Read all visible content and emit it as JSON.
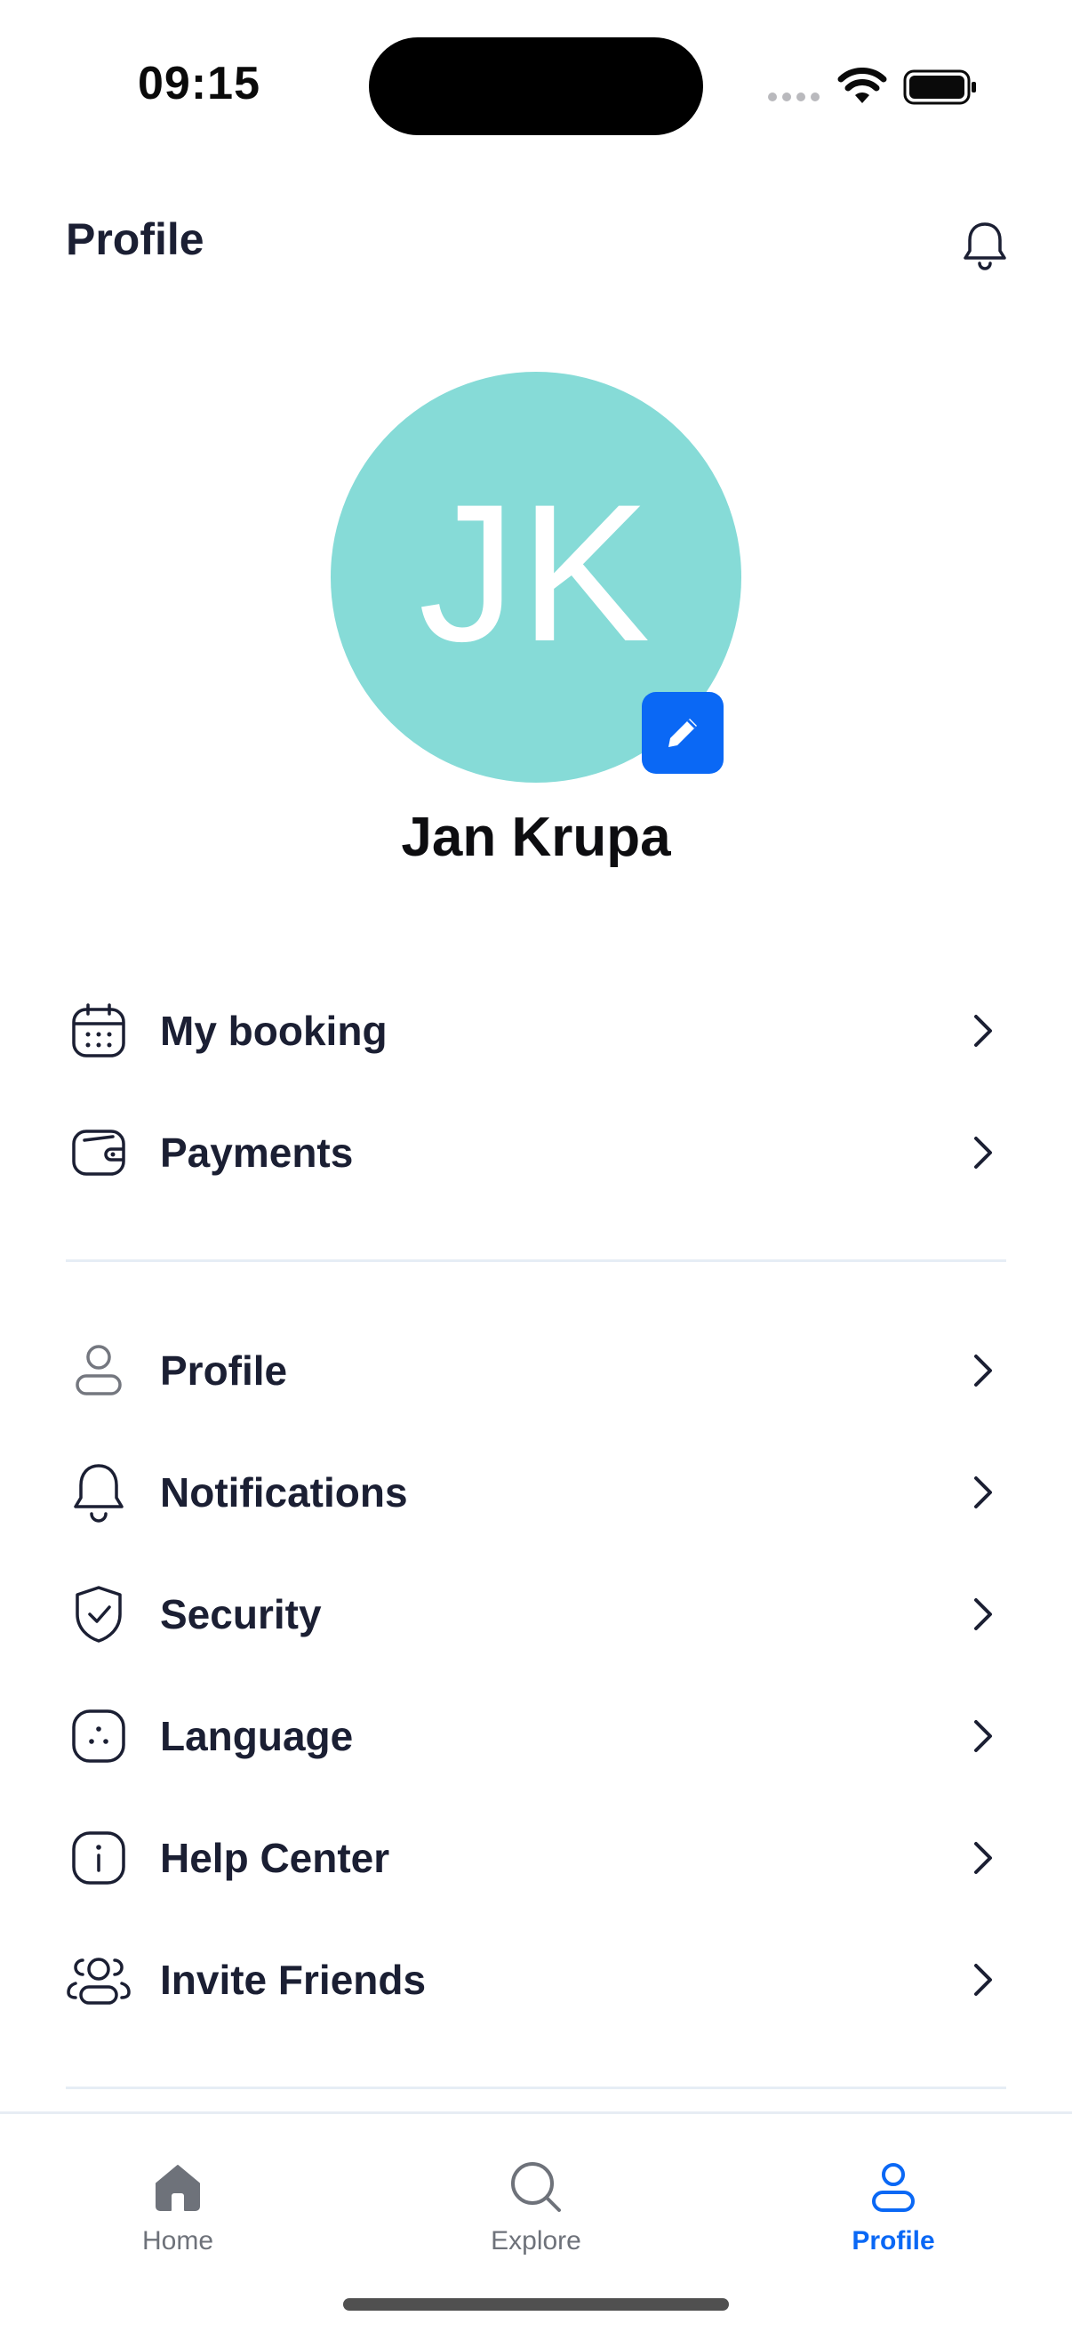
{
  "status_bar": {
    "time": "09:15"
  },
  "header": {
    "title": "Profile",
    "bell_icon": "bell-icon"
  },
  "profile": {
    "initials": "JK",
    "name": "Jan Krupa",
    "avatar_color": "#86dbd7",
    "edit_icon": "pencil-icon"
  },
  "menu_group_1": [
    {
      "label": "My booking",
      "icon": "calendar-icon"
    },
    {
      "label": "Payments",
      "icon": "wallet-icon"
    }
  ],
  "menu_group_2": [
    {
      "label": "Profile",
      "icon": "user-icon"
    },
    {
      "label": "Notifications",
      "icon": "bell-icon"
    },
    {
      "label": "Security",
      "icon": "shield-check-icon"
    },
    {
      "label": "Language",
      "icon": "language-icon"
    },
    {
      "label": "Help Center",
      "icon": "info-icon"
    },
    {
      "label": "Invite Friends",
      "icon": "users-icon"
    }
  ],
  "tab_bar": {
    "tabs": [
      {
        "label": "Home",
        "icon": "home-icon",
        "active": false
      },
      {
        "label": "Explore",
        "icon": "search-icon",
        "active": false
      },
      {
        "label": "Profile",
        "icon": "user-icon",
        "active": true
      }
    ]
  },
  "colors": {
    "accent": "#0a68f5",
    "text": "#1b1f33",
    "inactive": "#6e727a",
    "divider": "#e6edf5"
  }
}
